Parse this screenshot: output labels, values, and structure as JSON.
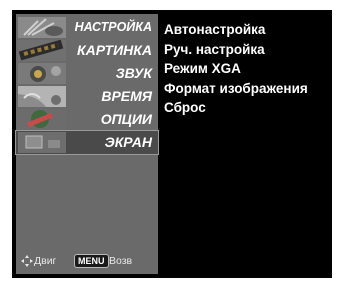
{
  "menu": {
    "items": [
      {
        "label": "НАСТРОЙКА",
        "icon": "satellite-dish-icon"
      },
      {
        "label": "КАРТИНКА",
        "icon": "film-strip-icon"
      },
      {
        "label": "ЗВУК",
        "icon": "speaker-icon"
      },
      {
        "label": "ВРЕМЯ",
        "icon": "clock-icon"
      },
      {
        "label": "ОПЦИИ",
        "icon": "special-badge-icon"
      },
      {
        "label": "ЭКРАН",
        "icon": "screen-icon"
      }
    ],
    "selected_index": 5
  },
  "submenu": {
    "items": [
      "Автонастройка",
      "Руч. настройка",
      "Режим XGA",
      "Формат изображения",
      "Сброс"
    ]
  },
  "footer": {
    "move_label": "Двиг",
    "menu_button_label": "MENU",
    "back_label": "Возв"
  },
  "colors": {
    "sidebar_bg": "#6a6a6a",
    "screen_bg": "#000000",
    "text": "#ffffff"
  }
}
